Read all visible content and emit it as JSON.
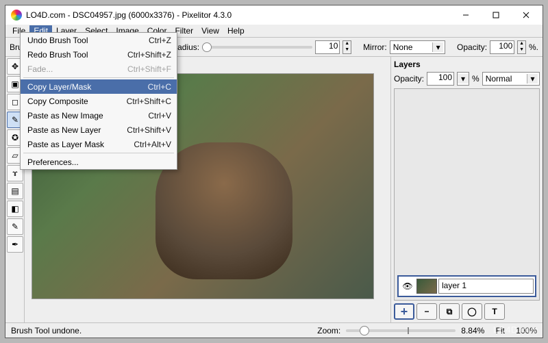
{
  "window": {
    "title": "LO4D.com - DSC04957.jpg (6000x3376) - Pixelitor 4.3.0"
  },
  "menubar": {
    "items": [
      "File",
      "Edit",
      "Layer",
      "Select",
      "Image",
      "Color",
      "Filter",
      "View",
      "Help"
    ],
    "open_index": 1
  },
  "edit_menu": {
    "items": [
      {
        "label": "Undo Brush Tool",
        "shortcut": "Ctrl+Z",
        "disabled": false
      },
      {
        "label": "Redo Brush Tool",
        "shortcut": "Ctrl+Shift+Z",
        "disabled": false
      },
      {
        "label": "Fade...",
        "shortcut": "Ctrl+Shift+F",
        "disabled": true
      },
      {
        "sep": true
      },
      {
        "label": "Copy Layer/Mask",
        "shortcut": "Ctrl+C",
        "highlight": true
      },
      {
        "label": "Copy Composite",
        "shortcut": "Ctrl+Shift+C"
      },
      {
        "label": "Paste as New Image",
        "shortcut": "Ctrl+V"
      },
      {
        "label": "Paste as New Layer",
        "shortcut": "Ctrl+Shift+V"
      },
      {
        "label": "Paste as Layer Mask",
        "shortcut": "Ctrl+Alt+V"
      },
      {
        "sep": true
      },
      {
        "label": "Preferences...",
        "shortcut": ""
      }
    ]
  },
  "options": {
    "brush_label": "Brush",
    "radius_label": "adius:",
    "radius_value": "10",
    "mirror_label": "Mirror:",
    "mirror_value": "None",
    "opacity_label": "Opacity:",
    "opacity_value": "100",
    "opacity_suffix": "%."
  },
  "tools": [
    {
      "name": "move",
      "icon": "✥"
    },
    {
      "name": "crop",
      "icon": "▣"
    },
    {
      "name": "marquee",
      "icon": "◻"
    },
    {
      "name": "brush",
      "icon": "✎",
      "selected": true
    },
    {
      "name": "stamp",
      "icon": "✪"
    },
    {
      "name": "eraser",
      "icon": "▱"
    },
    {
      "name": "smudge",
      "icon": "ɤ"
    },
    {
      "name": "gradient",
      "icon": "▤"
    },
    {
      "name": "bucket",
      "icon": "◧"
    },
    {
      "name": "picker",
      "icon": "✎"
    },
    {
      "name": "pen",
      "icon": "✒"
    }
  ],
  "layers": {
    "title": "Layers",
    "opacity_label": "Opacity:",
    "opacity_value": "100",
    "opacity_suffix": "%",
    "blend_mode": "Normal",
    "items": [
      {
        "name": "layer 1",
        "visible": true
      }
    ],
    "buttons": {
      "add": "+",
      "delete": "−",
      "duplicate": "⧉",
      "mask": "◯",
      "text": "T"
    }
  },
  "status": {
    "message": "Brush Tool undone.",
    "zoom_label": "Zoom:",
    "zoom_value": "8.84%",
    "fit_label": "Fit",
    "hundred_label": "100%"
  },
  "watermark": "LO4D.com"
}
